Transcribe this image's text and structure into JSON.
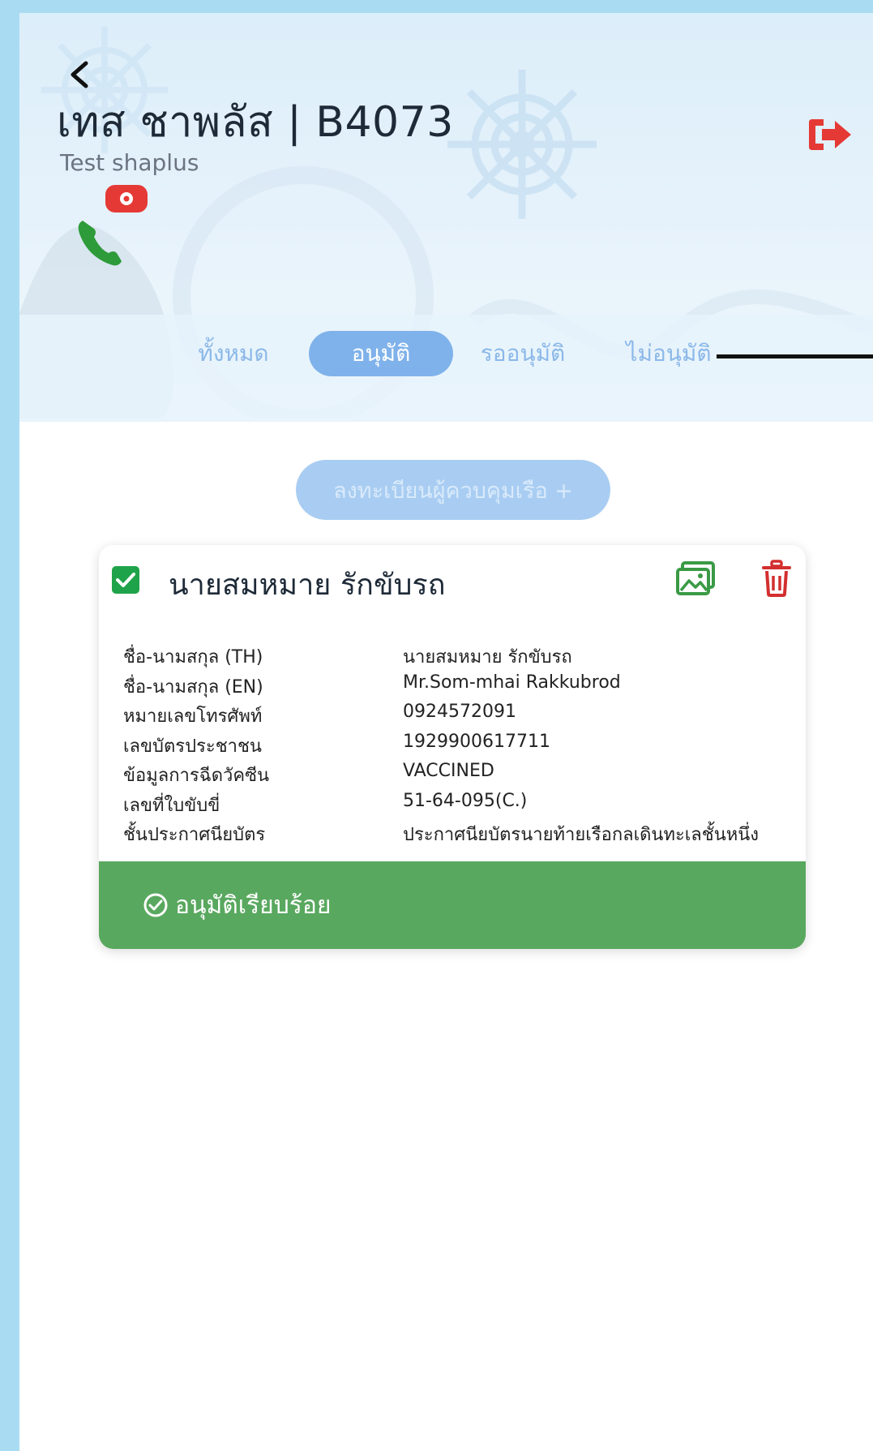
{
  "header": {
    "title": "เทส ชาพลัส | B4073",
    "subtitle": "Test shaplus"
  },
  "icons": {
    "back": "chevron-left-icon",
    "logout": "logout-icon",
    "sos": "emergency-call-icon",
    "checkbox": "checkbox-checked-icon",
    "image": "image-icon",
    "delete": "trash-icon",
    "status": "check-circle-icon"
  },
  "colors": {
    "accent": "#7fb2ea",
    "logout": "#e53935",
    "sos_call": "#2e9b3a",
    "approved_bar": "#59a85f",
    "delete": "#d32f2f",
    "check": "#1fa34a"
  },
  "tabs": [
    {
      "label": "ทั้งหมด",
      "active": false
    },
    {
      "label": "อนุมัติ",
      "active": true
    },
    {
      "label": "รออนุมัติ",
      "active": false
    },
    {
      "label": "ไม่อนุมัติ",
      "active": false
    }
  ],
  "register_button": {
    "label": "ลงทะเบียนผู้ควบคุมเรือ +"
  },
  "card": {
    "name": "นายสมหมาย รักขับรถ",
    "fields": [
      {
        "label": "ชื่อ-นามสกุล (TH)",
        "value": "นายสมหมาย รักขับรถ"
      },
      {
        "label": "ชื่อ-นามสกุล (EN)",
        "value": "Mr.Som-mhai Rakkubrod"
      },
      {
        "label": "หมายเลขโทรศัพท์",
        "value": "0924572091"
      },
      {
        "label": "เลขบัตรประชาชน",
        "value": "1929900617711"
      },
      {
        "label": "ข้อมูลการฉีดวัคซีน",
        "value": "VACCINED"
      },
      {
        "label": "เลขที่ใบขับขี่",
        "value": "51-64-095(C.)"
      },
      {
        "label": "ชั้นประกาศนียบัตร",
        "value": "ประกาศนียบัตรนายท้ายเรือกลเดินทะเลชั้นหนึ่ง"
      }
    ],
    "status": "อนุมัติเรียบร้อย"
  }
}
